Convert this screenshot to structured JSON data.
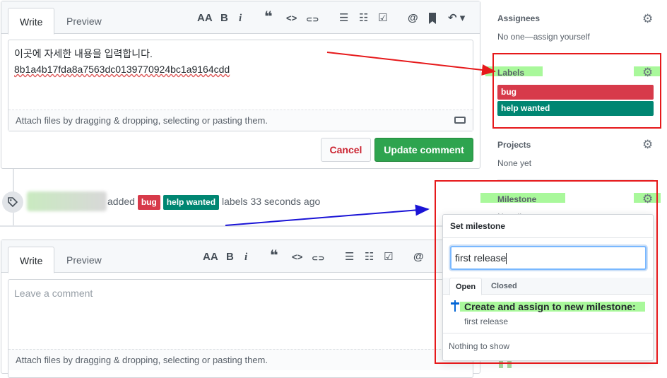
{
  "edit_comment": {
    "tabs": {
      "write": "Write",
      "preview": "Preview"
    },
    "line1": "이곳에 자세한 내용을 입력합니다.",
    "line2": "8b1a4b17fda8a7563dc0139770924bc1a9164cdd",
    "attach_hint": "Attach files by dragging & dropping, selecting or pasting them.",
    "cancel_label": "Cancel",
    "update_label": "Update comment"
  },
  "timeline_event": {
    "verb": "added",
    "labels": [
      {
        "name": "bug",
        "color": "#d73a4a"
      },
      {
        "name": "help wanted",
        "color": "#008672"
      }
    ],
    "suffix": "labels",
    "time": "33 seconds ago"
  },
  "new_comment": {
    "tabs": {
      "write": "Write",
      "preview": "Preview"
    },
    "placeholder": "Leave a comment",
    "attach_hint": "Attach files by dragging & dropping, selecting or pasting them."
  },
  "toolbar": {
    "heading": "AA",
    "bold": "B",
    "italic": "i",
    "quote": "❝",
    "code": "<>",
    "link": "⊂⊃",
    "ul": "☰",
    "ol": "☷",
    "task": "☑",
    "mention": "@",
    "bookmark": "🔖",
    "reply": "↶ ▾"
  },
  "sidebar": {
    "assignees": {
      "heading": "Assignees",
      "value": "No one—assign yourself"
    },
    "labels": {
      "heading": "Labels",
      "items": [
        {
          "name": "bug",
          "color": "#d73a4a"
        },
        {
          "name": "help wanted",
          "color": "#008672"
        }
      ]
    },
    "projects": {
      "heading": "Projects",
      "value": "None yet"
    },
    "milestone": {
      "heading": "Milestone",
      "value": "No milestone"
    }
  },
  "milestone_popover": {
    "title": "Set milestone",
    "input_value": "first release",
    "tabs": {
      "open": "Open",
      "closed": "Closed"
    },
    "create_label": "Create and assign to new milestone:",
    "create_name": "first release",
    "empty": "Nothing to show"
  },
  "colors": {
    "green_button": "#2ea44f",
    "annotation_red": "#e6191b",
    "annotation_blue": "#1a14d6",
    "highlight_green": "#8cf57a"
  }
}
